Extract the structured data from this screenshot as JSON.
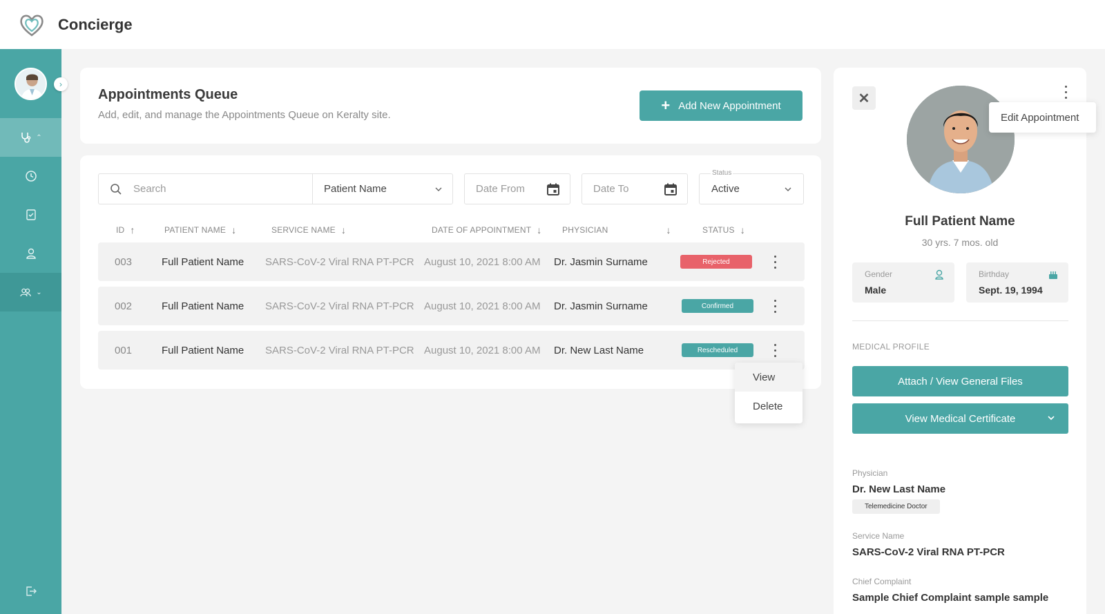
{
  "app": {
    "title": "Concierge"
  },
  "header": {
    "title": "Appointments Queue",
    "subtitle": "Add, edit, and manage the Appointments Queue on Keralty site.",
    "add_button": "Add New Appointment"
  },
  "filters": {
    "search_placeholder": "Search",
    "search_by": "Patient Name",
    "date_from_placeholder": "Date From",
    "date_to_placeholder": "Date To",
    "status_label": "Status",
    "status_value": "Active"
  },
  "table": {
    "columns": [
      "ID",
      "PATIENT NAME",
      "SERVICE NAME",
      "DATE OF APPOINTMENT",
      "PHYSICIAN",
      "STATUS"
    ],
    "rows": [
      {
        "id": "003",
        "patient": "Full Patient Name",
        "service": "SARS-CoV-2 Viral RNA PT-PCR",
        "date": "August 10, 2021  8:00 AM",
        "physician": "Dr. Jasmin Surname",
        "status": "Rejected"
      },
      {
        "id": "002",
        "patient": "Full Patient Name",
        "service": "SARS-CoV-2 Viral RNA PT-PCR",
        "date": "August 10, 2021  8:00 AM",
        "physician": "Dr. Jasmin Surname",
        "status": "Confirmed"
      },
      {
        "id": "001",
        "patient": "Full Patient Name",
        "service": "SARS-CoV-2 Viral RNA PT-PCR",
        "date": "August 10, 2021  8:00 AM",
        "physician": "Dr. New Last Name",
        "status": "Rescheduled"
      }
    ],
    "row_menu": [
      "View",
      "Delete"
    ]
  },
  "status_colors": {
    "rejected": "#e8626a",
    "confirmed": "#4aa6a5",
    "rescheduled": "#4aa6a5",
    "accent": "#4aa6a5"
  },
  "panel": {
    "edit_menu": "Edit Appointment",
    "patient_name": "Full Patient Name",
    "age": "30 yrs. 7 mos. old",
    "gender_label": "Gender",
    "gender": "Male",
    "birthday_label": "Birthday",
    "birthday": "Sept. 19, 1994",
    "medical_profile_label": "MEDICAL PROFILE",
    "attach_button": "Attach / View General Files",
    "certificate_button": "View Medical Certificate",
    "physician_label": "Physician",
    "physician": "Dr. New Last Name",
    "physician_tag": "Telemedicine Doctor",
    "service_label": "Service Name",
    "service": "SARS-CoV-2 Viral RNA PT-PCR",
    "complaint_label": "Chief Complaint",
    "complaint": "Sample Chief Complaint sample sample"
  },
  "icons": {
    "logo": "heart-logo-icon",
    "sidebar": [
      "stethoscope-icon",
      "clock-icon",
      "checklist-icon",
      "user-icon",
      "users-icon",
      "logout-icon"
    ]
  }
}
